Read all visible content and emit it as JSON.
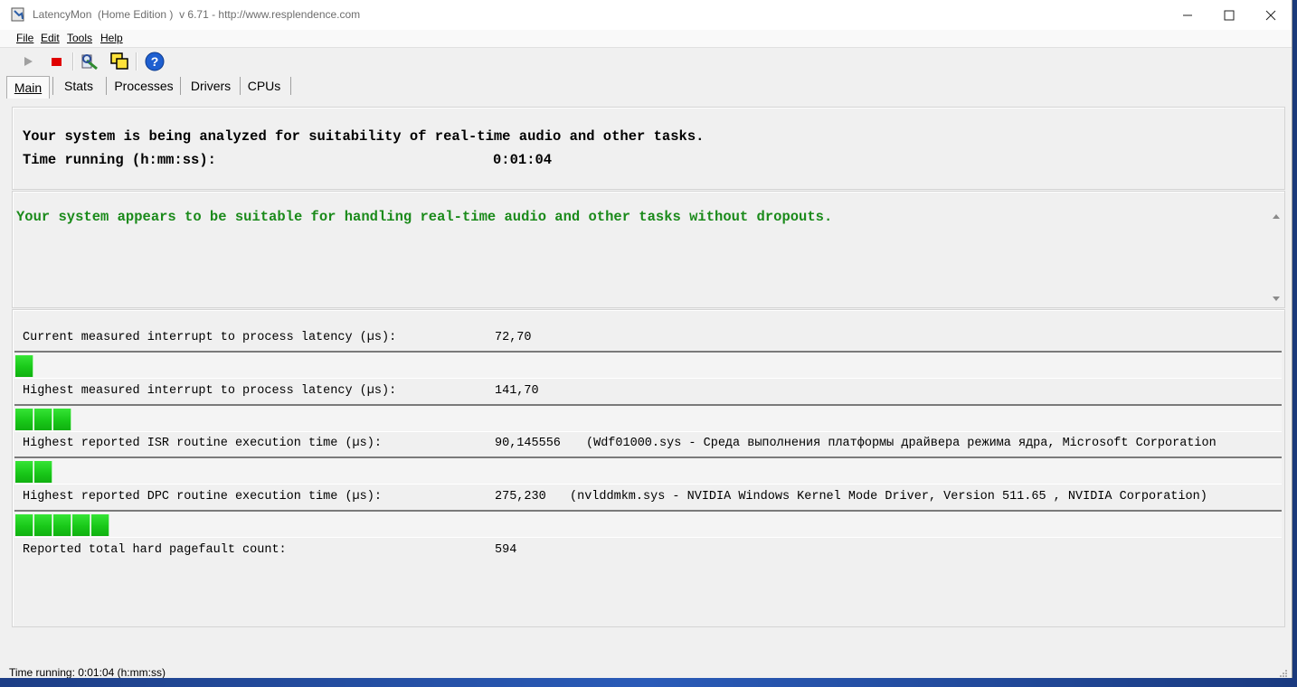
{
  "window": {
    "title": "LatencyMon  (Home Edition )  v 6.71 - http://www.resplendence.com"
  },
  "menu": [
    "File",
    "Edit",
    "Tools",
    "Help"
  ],
  "toolbar": {
    "icons": [
      "play-icon",
      "stop-icon",
      "tool-icon",
      "windows-icon",
      "help-icon"
    ]
  },
  "tabs": [
    "Main",
    "Stats",
    "Processes",
    "Drivers",
    "CPUs"
  ],
  "main": {
    "analysis_text": "Your system is being analyzed for suitability of real-time audio and other tasks.",
    "time_label": "Time running (h:mm:ss):",
    "time_value": "0:01:04",
    "verdict": "Your system appears to be suitable for handling real-time audio and other tasks without dropouts.",
    "metrics": [
      {
        "label": "Current measured interrupt to process latency (µs):",
        "value": "72,70",
        "detail": "",
        "bar_segments": 1
      },
      {
        "label": "Highest measured interrupt to process latency (µs):",
        "value": "141,70",
        "detail": "",
        "bar_segments": 3
      },
      {
        "label": "Highest reported ISR routine execution time (µs):",
        "value": "90,145556",
        "detail": "(Wdf01000.sys - Среда выполнения платформы драйвера режима ядра, Microsoft Corporation",
        "bar_segments": 2
      },
      {
        "label": "Highest reported DPC routine execution time (µs):",
        "value": "275,230",
        "detail": "(nvlddmkm.sys - NVIDIA Windows Kernel Mode Driver, Version 511.65 , NVIDIA Corporation)",
        "bar_segments": 5
      }
    ],
    "pagefault_label": "Reported total hard pagefault count:",
    "pagefault_value": "594"
  },
  "status": {
    "text": "Time running: 0:01:04  (h:mm:ss)"
  },
  "colors": {
    "bar_green": "#19c819",
    "verdict_green": "#1a8a1a",
    "stop_red": "#e00000",
    "help_blue": "#1e5fd0"
  }
}
